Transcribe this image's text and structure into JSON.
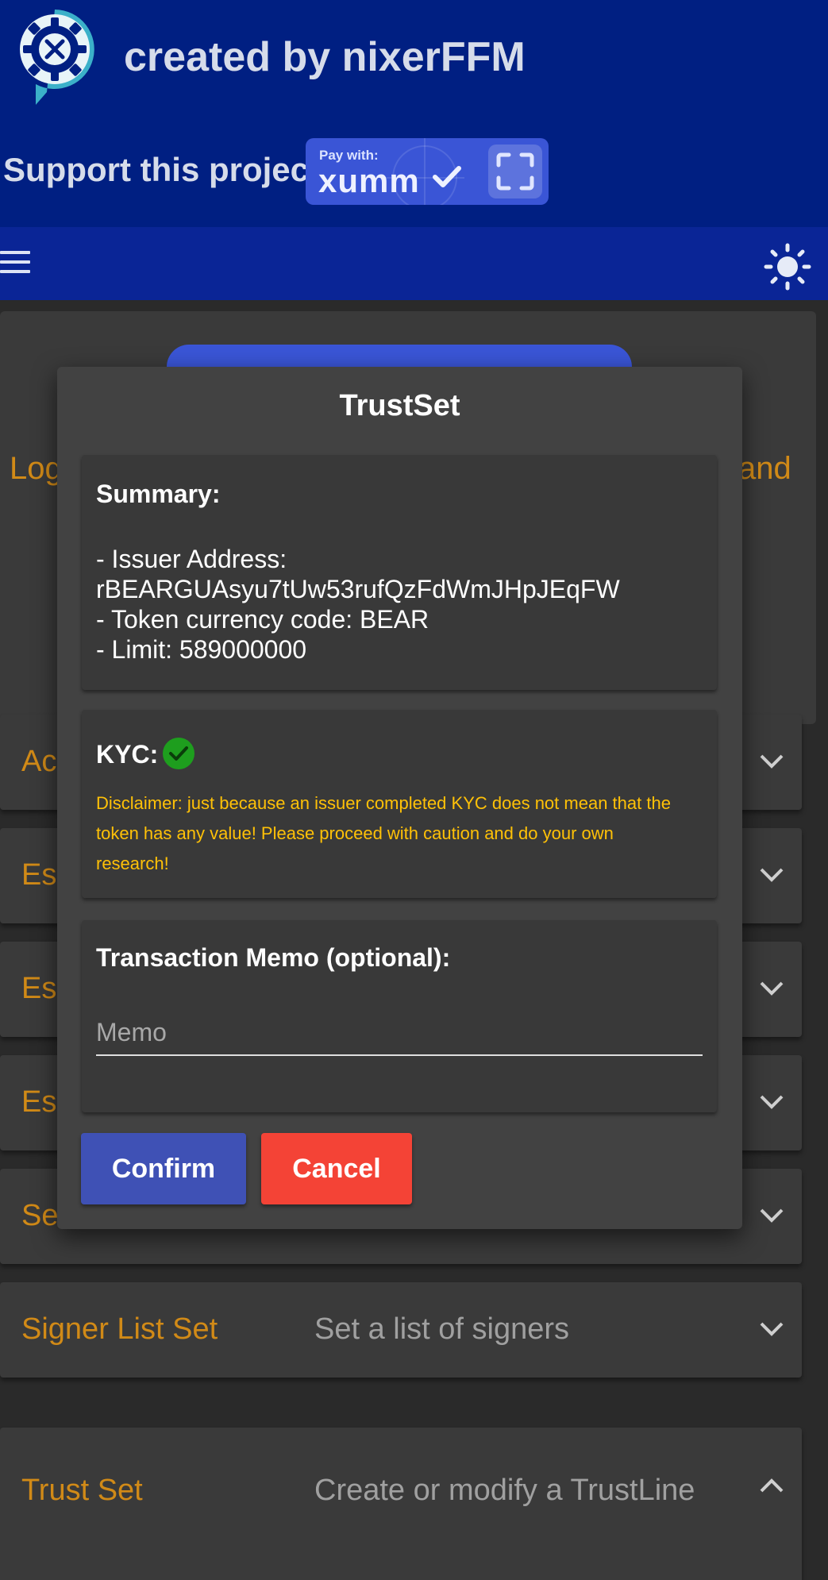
{
  "header": {
    "created_by": "created by nixerFFM",
    "support_label": "Support this project:",
    "xumm_pay_with": "Pay with:",
    "xumm_brand": "xumm"
  },
  "toolbar": {
    "menu_icon": "hamburger-menu-icon",
    "theme_icon": "sun-icon"
  },
  "background": {
    "login_left": "Log",
    "login_right": "and",
    "accordions": [
      {
        "title": "Ac",
        "desc": ""
      },
      {
        "title": "Es",
        "desc": ""
      },
      {
        "title": "Es",
        "desc": ""
      },
      {
        "title": "Es",
        "desc": ""
      },
      {
        "title": "Se",
        "desc": ""
      },
      {
        "title": "Signer List Set",
        "desc": "Set a list of signers"
      },
      {
        "title": "Trust Set",
        "desc": "Create or modify a TrustLine"
      }
    ]
  },
  "modal": {
    "title": "TrustSet",
    "summary": {
      "heading": "Summary:",
      "issuer_label": "- Issuer Address:",
      "issuer_address": "rBEARGUAsyu7tUw53rufQzFdWmJHpJEqFW",
      "currency_line": "- Token currency code: BEAR",
      "limit_line": "- Limit: 589000000"
    },
    "kyc": {
      "heading": "KYC:",
      "status_icon": "check-circle-icon",
      "status_color": "#1e9e1e",
      "disclaimer": "Disclaimer: just because an issuer completed KYC does not mean that the token has any value! Please proceed with caution and do your own research!"
    },
    "memo": {
      "heading": "Transaction Memo (optional):",
      "placeholder": "Memo",
      "value": ""
    },
    "buttons": {
      "confirm": "Confirm",
      "cancel": "Cancel"
    }
  },
  "colors": {
    "header_bg": "#001f82",
    "toolbar_bg": "#0a2596",
    "accent_orange": "#d18a17",
    "disclaimer": "#ffc107",
    "confirm": "#3f51b5",
    "cancel": "#f44336"
  }
}
